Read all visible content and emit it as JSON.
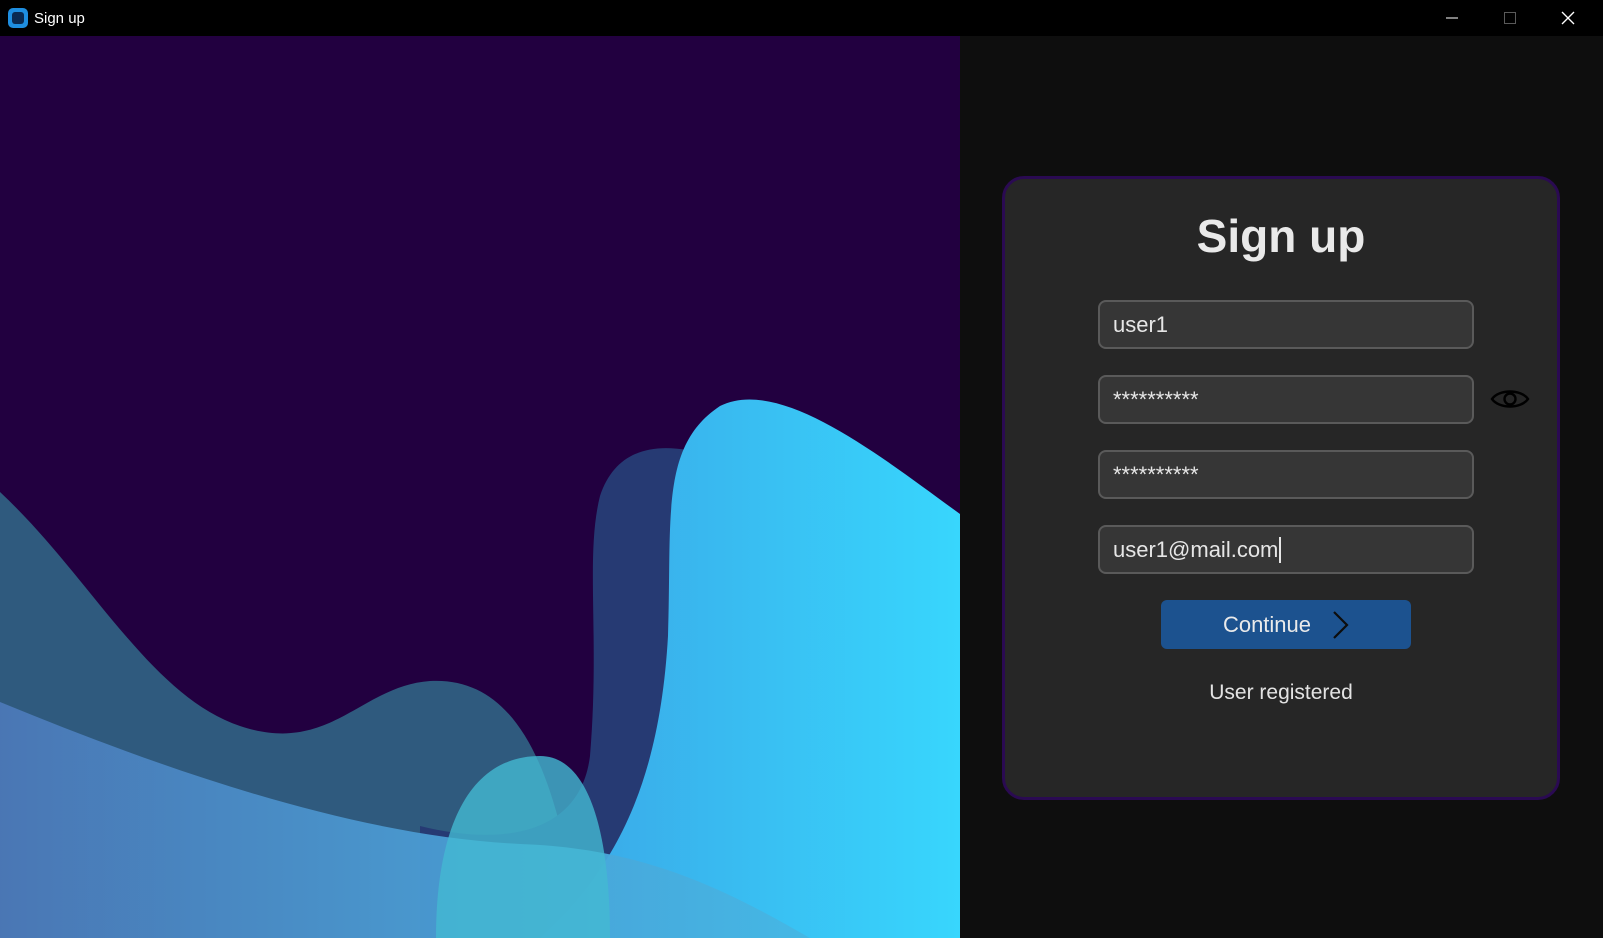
{
  "window": {
    "title": "Sign up",
    "app_icon": "app-square-icon",
    "controls": [
      "minimize-icon",
      "maximize-icon",
      "close-icon"
    ]
  },
  "art": {
    "background_color": "#220040",
    "wave_colors": [
      "#2f5a7e",
      "#4a78b6",
      "#263a73",
      "#3ec8f2",
      "#43b9d2"
    ]
  },
  "form": {
    "title": "Sign up",
    "username_value": "user1",
    "password_value": "**********",
    "confirm_password_value": "**********",
    "email_value": "user1@mail.com",
    "show_password_icon": "eye-icon",
    "continue_label": "Continue",
    "continue_icon": "chevron-right-icon",
    "status_text": "User registered"
  },
  "colors": {
    "card_bg": "#262626",
    "card_border": "#2a0a52",
    "field_bg": "#363636",
    "button_bg": "#1c528f"
  }
}
